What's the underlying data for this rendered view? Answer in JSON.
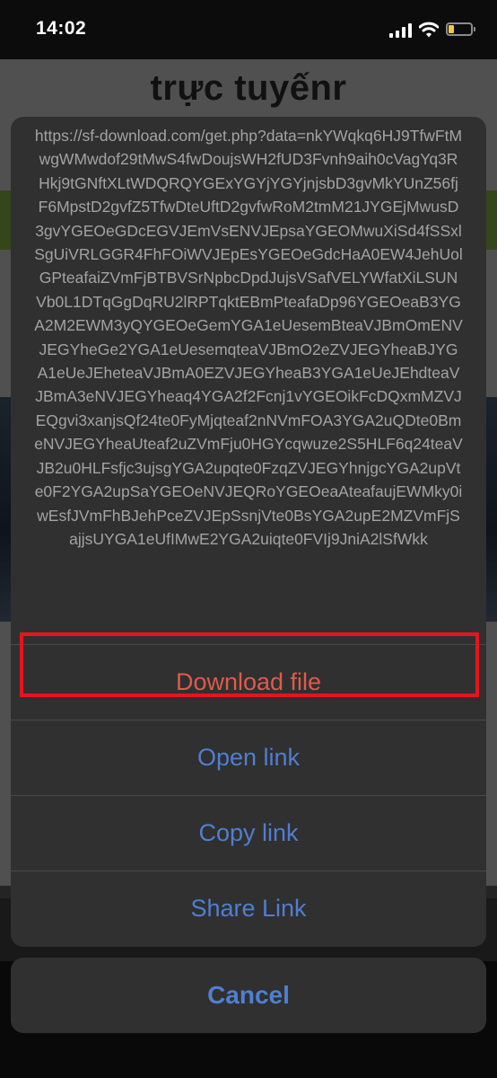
{
  "status_bar": {
    "time": "14:02",
    "battery_fill_fraction": 0.25,
    "battery_color": "#f2c740"
  },
  "background_page": {
    "title": "trực tuyếnr"
  },
  "action_sheet": {
    "url_text": "https://sf-download.com/get.php?data=nkYWqkq6HJ9TfwFtMwgWMwdof29tMwS4fwDoujsWH2fUD3Fvnh9aih0cVagYq3RHkj9tGNftXLtWDQRQYGExYGYjYGYjnjsbD3gvMkYUnZ56fjF6MpstD2gvfZ5TfwDteUftD2gvfwRoM2tmM21JYGEjMwusD3gvYGEOeGDcEGVJEmVsENVJEpsaYGEOMwuXiSd4fSSxlSgUiVRLGGR4FhFOiWVJEpEsYGEOeGdcHaA0EW4JehUolGPteafaiZVmFjBTBVSrNpbcDpdJujsVSafVELYWfatXiLSUNVb0L1DTqGgDqRU2lRPTqktEBmPteafaDp96YGEOeaB3YGA2M2EWM3yQYGEOeGemYGA1eUesemBteaVJBmOmENVJEGYheGe2YGA1eUesemqteaVJBmO2eZVJEGYheaBJYGA1eUeJEheteaVJBmA0EZVJEGYheaB3YGA1eUeJEhdteaVJBmA3eNVJEGYheaq4YGA2f2Fcnj1vYGEOikFcDQxmMZVJEQgvi3xanjsQf24te0FyMjqteaf2nNVmFOA3YGA2uQDte0BmeNVJEGYheaUteaf2uZVmFju0HGYcqwuze2S5HLF6q24teaVJB2u0HLFsfjc3ujsgYGA2upqte0FzqZVJEGYhnjgcYGA2upVte0F2YGA2upSaYGEOeNVJEQRoYGEOeaAteafaujEWMky0iwEsfJVmFhBJehPceZVJEpSsnjVte0BsYGA2upE2MZVmFjSajjsUYGA1eUfIMwE2YGA2uiqte0FVIj9JniA2lSfWkk",
    "options": {
      "download": "Download file",
      "open": "Open link",
      "copy": "Copy link",
      "share": "Share Link"
    },
    "cancel": "Cancel",
    "colors": {
      "destructive": "#e05a4c",
      "action": "#4f7fd0",
      "highlight": "#e8141c"
    }
  }
}
